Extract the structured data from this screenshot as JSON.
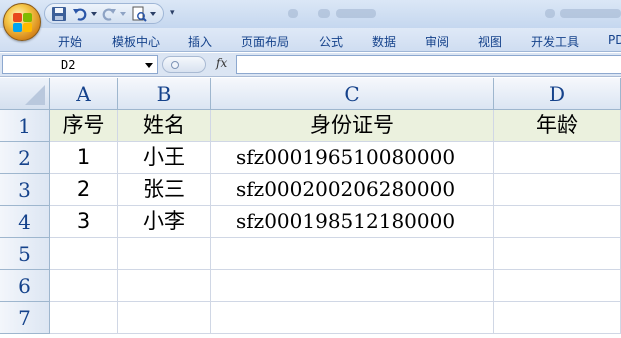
{
  "quick_access": {
    "customize_glyph": "▾",
    "icons": [
      "save-icon",
      "undo-icon",
      "redo-icon",
      "print-preview-icon"
    ]
  },
  "ribbon": {
    "tabs": [
      "开始",
      "模板中心",
      "插入",
      "页面布局",
      "公式",
      "数据",
      "审阅",
      "视图",
      "开发工具",
      "PD"
    ]
  },
  "formula_bar": {
    "name_box": "D2",
    "fx_label": "fx",
    "formula": ""
  },
  "grid": {
    "columns": [
      "A",
      "B",
      "C",
      "D"
    ],
    "rows": [
      "1",
      "2",
      "3",
      "4",
      "5",
      "6",
      "7"
    ],
    "cells": [
      [
        "序号",
        "姓名",
        "身份证号",
        "年龄"
      ],
      [
        "1",
        "小王",
        "sfz000196510080000",
        ""
      ],
      [
        "2",
        "张三",
        "sfz000200206280000",
        ""
      ],
      [
        "3",
        "小李",
        "sfz000198512180000",
        ""
      ],
      [
        "",
        "",
        "",
        ""
      ],
      [
        "",
        "",
        "",
        ""
      ],
      [
        "",
        "",
        "",
        ""
      ]
    ],
    "header_row_fill": "#ebf1de",
    "header_color": "#15428b"
  }
}
